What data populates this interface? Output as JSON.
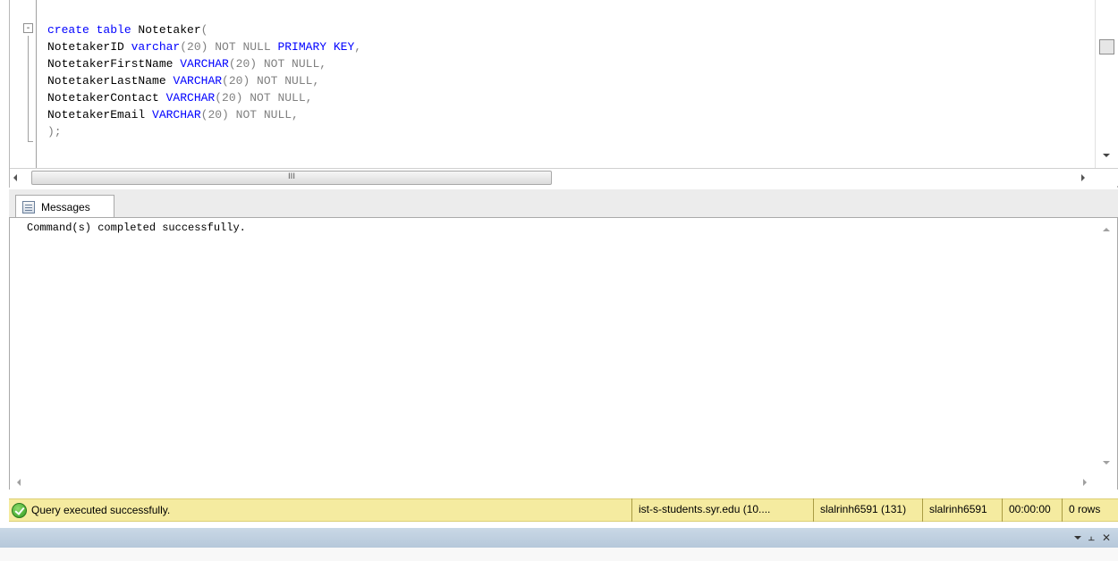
{
  "editor": {
    "fold_toggle": "-",
    "lines": [
      [
        {
          "t": "create table ",
          "c": "kw-blue"
        },
        {
          "t": "Notetaker",
          "c": "ident"
        },
        {
          "t": "(",
          "c": "kw-gray"
        }
      ],
      [
        {
          "t": "NotetakerID ",
          "c": "ident"
        },
        {
          "t": "varchar",
          "c": "kw-blue"
        },
        {
          "t": "(20) NOT NULL ",
          "c": "kw-gray"
        },
        {
          "t": "PRIMARY KEY",
          "c": "kw-blue"
        },
        {
          "t": ",",
          "c": "kw-gray"
        }
      ],
      [
        {
          "t": "NotetakerFirstName ",
          "c": "ident"
        },
        {
          "t": "VARCHAR",
          "c": "kw-blue"
        },
        {
          "t": "(20) NOT NULL,",
          "c": "kw-gray"
        }
      ],
      [
        {
          "t": "NotetakerLastName ",
          "c": "ident"
        },
        {
          "t": "VARCHAR",
          "c": "kw-blue"
        },
        {
          "t": "(20) NOT NULL,",
          "c": "kw-gray"
        }
      ],
      [
        {
          "t": "NotetakerContact ",
          "c": "ident"
        },
        {
          "t": "VARCHAR",
          "c": "kw-blue"
        },
        {
          "t": "(20) NOT NULL,",
          "c": "kw-gray"
        }
      ],
      [
        {
          "t": "NotetakerEmail ",
          "c": "ident"
        },
        {
          "t": "VARCHAR",
          "c": "kw-blue"
        },
        {
          "t": "(20) NOT NULL,",
          "c": "kw-gray"
        }
      ],
      [
        {
          "t": ");",
          "c": "kw-gray"
        }
      ]
    ],
    "hscroll_grip": "III"
  },
  "results": {
    "tab_label": "Messages",
    "tab_icon": "messages-icon",
    "message": "Command(s) completed successfully."
  },
  "status": {
    "icon": "success-check-icon",
    "message": "Query executed successfully.",
    "server": "ist-s-students.syr.edu (10....",
    "user_session": "slalrinh6591 (131)",
    "user": "slalrinh6591",
    "elapsed": "00:00:00",
    "rows": "0 rows"
  },
  "dock": {
    "pin_glyph": "⫠",
    "close_glyph": "✕"
  },
  "colors": {
    "keyword": "#0000ff",
    "operator": "#808080",
    "status_bar": "#f5eba0",
    "dock_title": "#c9d8e6"
  }
}
